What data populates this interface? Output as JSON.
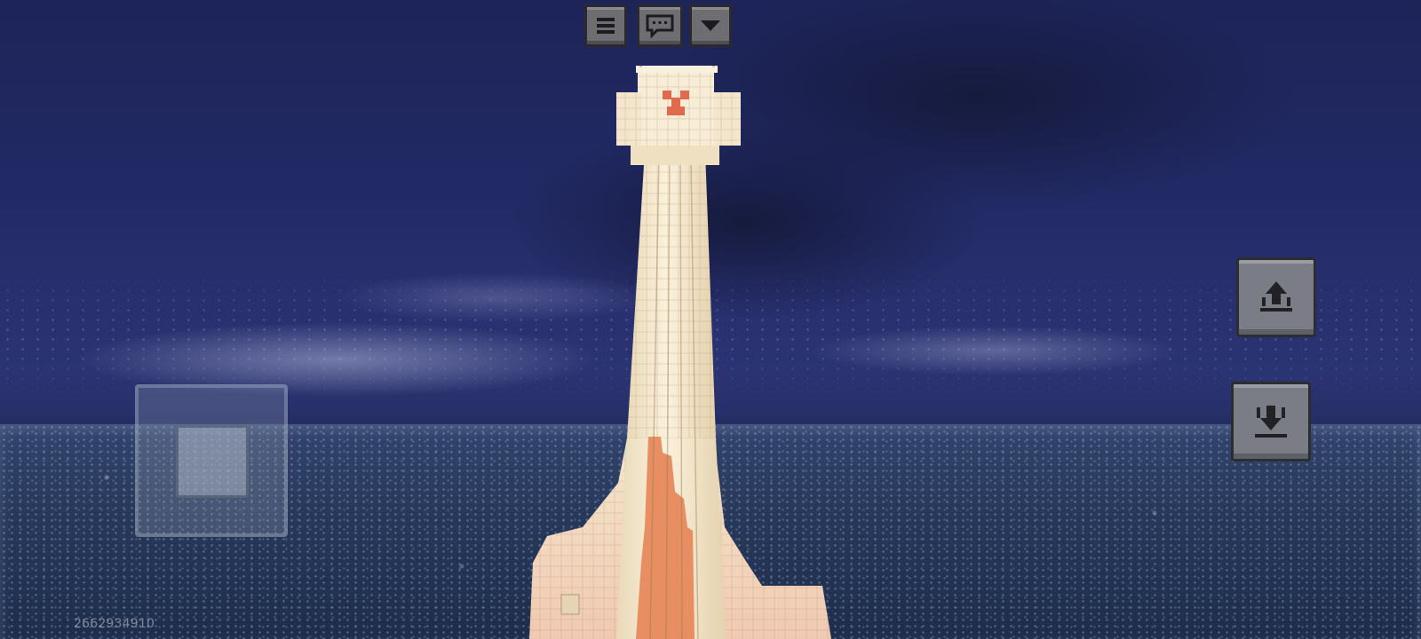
{
  "hud": {
    "top_buttons": [
      {
        "id": "menu",
        "icon": "hamburger-menu-icon"
      },
      {
        "id": "chat",
        "icon": "chat-bubble-icon"
      },
      {
        "id": "dropdown",
        "icon": "triangle-down-icon"
      }
    ],
    "right_buttons": [
      {
        "id": "fly-up",
        "icon": "fly-up-arrow-icon"
      },
      {
        "id": "fly-down",
        "icon": "fly-down-arrow-icon"
      }
    ],
    "seed": "2662934910"
  },
  "colors": {
    "button_face": "#6d6d72",
    "button_border": "#2a2a2e",
    "tower_light": "#f6ead2",
    "tower_accent": "#e58a5f"
  }
}
